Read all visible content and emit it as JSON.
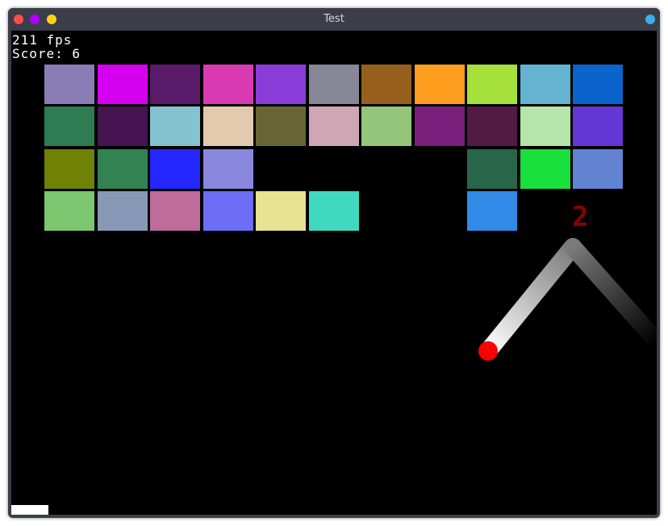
{
  "window": {
    "title": "Test",
    "controls": {
      "close_color": "#ff4d4d",
      "minimize_color": "#b400ff",
      "maximize_color": "#ffd21a",
      "extra_color": "#3daee9"
    }
  },
  "hud": {
    "fps_text": "211 fps",
    "score_text": "Score: 6"
  },
  "popup_text": "2",
  "bricks": [
    {
      "row": 0,
      "col": 0,
      "color": "#8a7db5"
    },
    {
      "row": 0,
      "col": 1,
      "color": "#d600f0"
    },
    {
      "row": 0,
      "col": 2,
      "color": "#5a1a6a"
    },
    {
      "row": 0,
      "col": 3,
      "color": "#d93ab2"
    },
    {
      "row": 0,
      "col": 4,
      "color": "#8a3cd9"
    },
    {
      "row": 0,
      "col": 5,
      "color": "#878797"
    },
    {
      "row": 0,
      "col": 6,
      "color": "#96601c"
    },
    {
      "row": 0,
      "col": 7,
      "color": "#ff9d1f"
    },
    {
      "row": 0,
      "col": 8,
      "color": "#a6e03a"
    },
    {
      "row": 0,
      "col": 9,
      "color": "#64b3d1"
    },
    {
      "row": 0,
      "col": 10,
      "color": "#0b64cc"
    },
    {
      "row": 1,
      "col": 0,
      "color": "#2e7c52"
    },
    {
      "row": 1,
      "col": 1,
      "color": "#461450"
    },
    {
      "row": 1,
      "col": 2,
      "color": "#85c2cf"
    },
    {
      "row": 1,
      "col": 3,
      "color": "#e3c9ad"
    },
    {
      "row": 1,
      "col": 4,
      "color": "#6a6535"
    },
    {
      "row": 1,
      "col": 5,
      "color": "#cfa6b4"
    },
    {
      "row": 1,
      "col": 6,
      "color": "#94c57b"
    },
    {
      "row": 1,
      "col": 7,
      "color": "#781f7b"
    },
    {
      "row": 1,
      "col": 8,
      "color": "#521b44"
    },
    {
      "row": 1,
      "col": 9,
      "color": "#b6e5ab"
    },
    {
      "row": 1,
      "col": 10,
      "color": "#6437d4"
    },
    {
      "row": 2,
      "col": 0,
      "color": "#6f8206"
    },
    {
      "row": 2,
      "col": 1,
      "color": "#338252"
    },
    {
      "row": 2,
      "col": 2,
      "color": "#2427ff"
    },
    {
      "row": 2,
      "col": 3,
      "color": "#8a88de"
    },
    {
      "row": 2,
      "col": 8,
      "color": "#28664a"
    },
    {
      "row": 2,
      "col": 9,
      "color": "#18e03c"
    },
    {
      "row": 2,
      "col": 10,
      "color": "#6283d1"
    },
    {
      "row": 3,
      "col": 0,
      "color": "#7dc670"
    },
    {
      "row": 3,
      "col": 1,
      "color": "#8898b7"
    },
    {
      "row": 3,
      "col": 2,
      "color": "#bd6c9b"
    },
    {
      "row": 3,
      "col": 3,
      "color": "#6c6ef6"
    },
    {
      "row": 3,
      "col": 4,
      "color": "#e8e291"
    },
    {
      "row": 3,
      "col": 5,
      "color": "#3ed9c0"
    },
    {
      "row": 3,
      "col": 8,
      "color": "#318ae6"
    }
  ]
}
